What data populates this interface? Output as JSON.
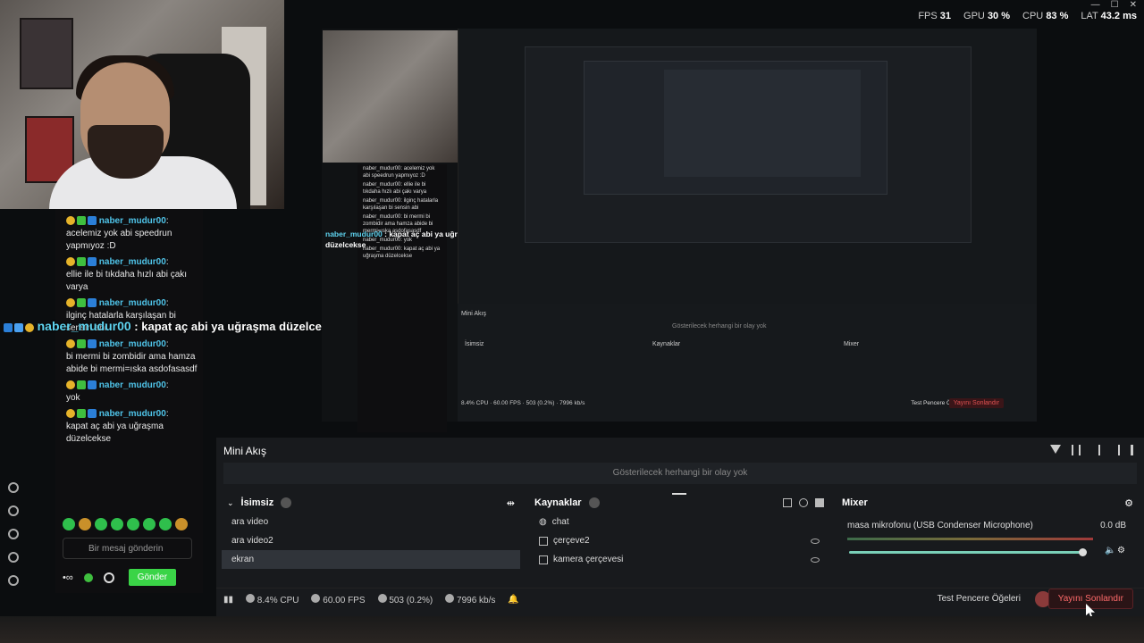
{
  "top_stats": {
    "fps_label": "FPS",
    "fps": "31",
    "gpu_label": "GPU",
    "gpu": "30 %",
    "cpu_label": "CPU",
    "cpu": "83 %",
    "lat_label": "LAT",
    "lat": "43.2 ms"
  },
  "chat": {
    "messages": [
      {
        "user": "naber_mudur00",
        "text": "acelemiz yok abi speedrun yapmıyoz :D"
      },
      {
        "user": "naber_mudur00",
        "text": "ellie ile bi tıkdaha hızlı abi çakı varya"
      },
      {
        "user": "naber_mudur00",
        "text": "ilginç hatalarla karşılaşan bi sensin abi"
      },
      {
        "user": "naber_mudur00",
        "text": "bi mermi bi zombidir ama hamza abide bi mermi=ıska asdofasasdf"
      },
      {
        "user": "naber_mudur00",
        "text": "yok"
      },
      {
        "user": "naber_mudur00",
        "text": "kapat aç abi ya uğraşma düzelcekse"
      }
    ],
    "placeholder": "Bir mesaj gönderin",
    "send_label": "Gönder"
  },
  "overlay_caption": {
    "user": "naber_mudur00",
    "text": ": kapat aç abi ya uğraşma düzelcekse"
  },
  "mini_feed": {
    "title": "Mini Akış",
    "empty_text": "Gösterilecek herhangi bir olay yok"
  },
  "scenes": {
    "title": "İsimsiz",
    "items": [
      "ara video",
      "ara video2",
      "ekran"
    ],
    "selected": "ekran"
  },
  "sources": {
    "title": "Kaynaklar",
    "items": [
      "chat",
      "çerçeve2",
      "kamera çerçevesi"
    ]
  },
  "mixer": {
    "title": "Mixer",
    "device": "masa mikrofonu (USB Condenser Microphone)",
    "db": "0.0 dB",
    "volume_fraction": 0.98
  },
  "status_bar": {
    "cpu": "8.4% CPU",
    "fps": "60.00 FPS",
    "dropped": "503 (0.2%)",
    "bitrate": "7996 kb/s"
  },
  "test_label": "Test Pencere Öğeleri",
  "end_stream_label": "Yayını Sonlandır",
  "colors": {
    "accent_green": "#3ad447",
    "username_blue": "#4fc3e8",
    "end_red": "#ff6b6b"
  }
}
